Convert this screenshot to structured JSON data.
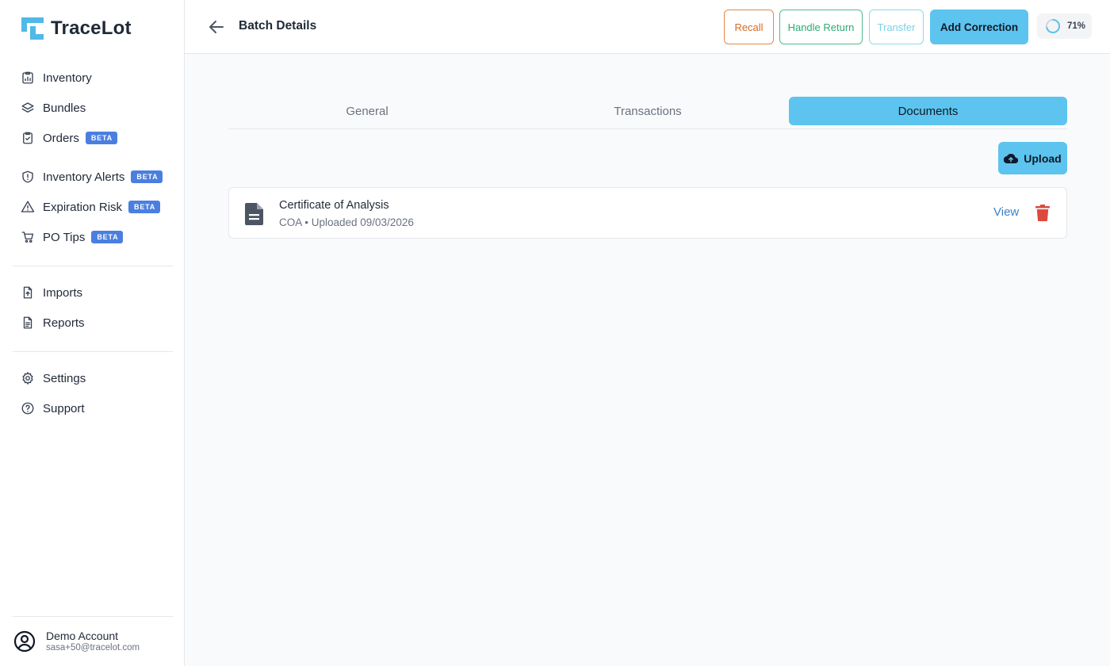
{
  "app": {
    "name": "TraceLot"
  },
  "sidebar": {
    "items": [
      {
        "label": "Inventory",
        "icon": "inventory-chart-icon",
        "badge": ""
      },
      {
        "label": "Bundles",
        "icon": "layers-icon",
        "badge": ""
      },
      {
        "label": "Orders",
        "icon": "clipboard-check-icon",
        "badge": "BETA"
      },
      {
        "label": "Inventory Alerts",
        "icon": "shield-alert-icon",
        "badge": "BETA"
      },
      {
        "label": "Expiration Risk",
        "icon": "warning-triangle-icon",
        "badge": "BETA"
      },
      {
        "label": "PO Tips",
        "icon": "shopping-cart-icon",
        "badge": "BETA"
      },
      {
        "label": "Imports",
        "icon": "file-import-icon",
        "badge": ""
      },
      {
        "label": "Reports",
        "icon": "file-report-icon",
        "badge": ""
      },
      {
        "label": "Settings",
        "icon": "gear-icon",
        "badge": ""
      },
      {
        "label": "Support",
        "icon": "help-circle-icon",
        "badge": ""
      }
    ],
    "account": {
      "name": "Demo Account",
      "email": "sasa+50@tracelot.com"
    }
  },
  "header": {
    "title": "Batch Details",
    "buttons": {
      "recall": "Recall",
      "handle_return": "Handle Return",
      "transfer": "Transfer",
      "add_correction": "Add Correction"
    },
    "progress": {
      "label": "71%",
      "value": 0.71
    }
  },
  "tabs": [
    {
      "label": "General",
      "active": false
    },
    {
      "label": "Transactions",
      "active": false
    },
    {
      "label": "Documents",
      "active": true
    }
  ],
  "documents": {
    "upload_label": "Upload",
    "items": [
      {
        "name": "Certificate of Analysis",
        "meta": "COA • Uploaded 09/03/2026",
        "view_label": "View"
      }
    ]
  },
  "colors": {
    "accent": "#5cc4ee",
    "beta_badge": "#4a7fe0",
    "recall": "#d46d22",
    "handle_return": "#2eaa76",
    "transfer": "#7dd0e6",
    "delete": "#dc4a3f",
    "link": "#3b82c4"
  }
}
